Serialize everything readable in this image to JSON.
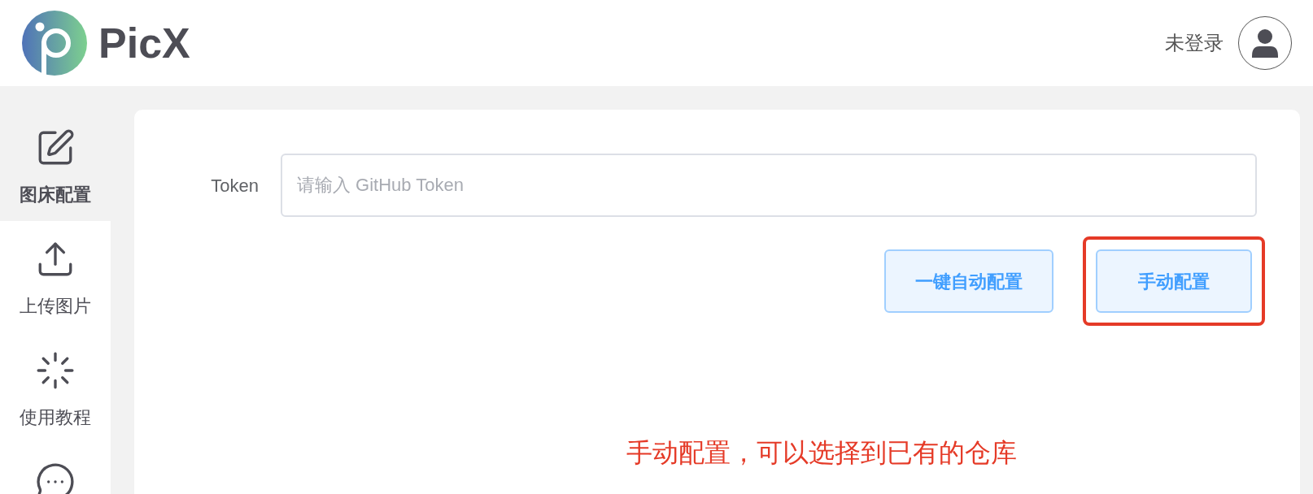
{
  "header": {
    "app_name": "PicX",
    "login_status": "未登录"
  },
  "sidebar": {
    "items": [
      {
        "kind": "edit",
        "label": "图床配置",
        "selected": true
      },
      {
        "kind": "upload",
        "label": "上传图片",
        "selected": false
      },
      {
        "kind": "tutorial",
        "label": "使用教程",
        "selected": false
      },
      {
        "kind": "chat",
        "selected": false
      }
    ]
  },
  "form": {
    "token_label": "Token",
    "token_placeholder": "请输入 GitHub Token",
    "buttons": [
      {
        "label": "一键自动配置",
        "highlighted": false
      },
      {
        "label": "手动配置",
        "highlighted": true
      }
    ]
  },
  "annotation": "手动配置，可以选择到已有的仓库"
}
